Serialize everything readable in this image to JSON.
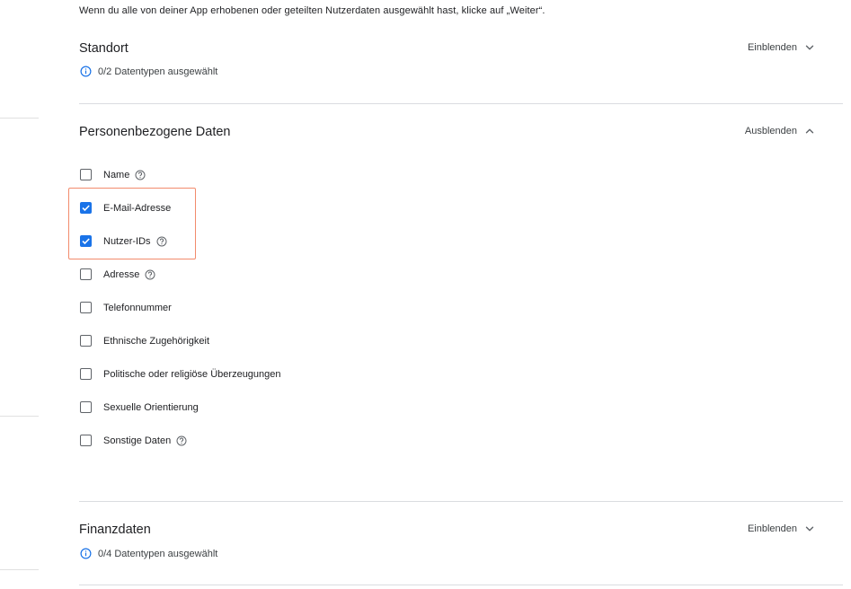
{
  "intro_text": "Wenn du alle von deiner App erhobenen oder geteilten Nutzerdaten ausgewählt hast, klicke auf „Weiter“.",
  "sections": {
    "location": {
      "title": "Standort",
      "toggle_label": "Einblenden",
      "summary": "0/2 Datentypen ausgewählt"
    },
    "personal": {
      "title": "Personenbezogene Daten",
      "toggle_label": "Ausblenden",
      "items": [
        {
          "label": "Name",
          "checked": false,
          "help": true
        },
        {
          "label": "E-Mail-Adresse",
          "checked": true,
          "help": false
        },
        {
          "label": "Nutzer-IDs",
          "checked": true,
          "help": true
        },
        {
          "label": "Adresse",
          "checked": false,
          "help": true
        },
        {
          "label": "Telefonnummer",
          "checked": false,
          "help": false
        },
        {
          "label": "Ethnische Zugehörigkeit",
          "checked": false,
          "help": false
        },
        {
          "label": "Politische oder religiöse Überzeugungen",
          "checked": false,
          "help": false
        },
        {
          "label": "Sexuelle Orientierung",
          "checked": false,
          "help": false
        },
        {
          "label": "Sonstige Daten",
          "checked": false,
          "help": true
        }
      ]
    },
    "financial": {
      "title": "Finanzdaten",
      "toggle_label": "Einblenden",
      "summary": "0/4 Datentypen ausgewählt"
    }
  },
  "colors": {
    "checkbox_checked": "#1a73e8",
    "highlight_border": "#f28b6c",
    "info_icon": "#1a73e8"
  },
  "icons": {
    "info": "info-icon",
    "help": "help-circle-icon",
    "expand": "chevron-down-icon",
    "collapse": "chevron-up-icon"
  }
}
